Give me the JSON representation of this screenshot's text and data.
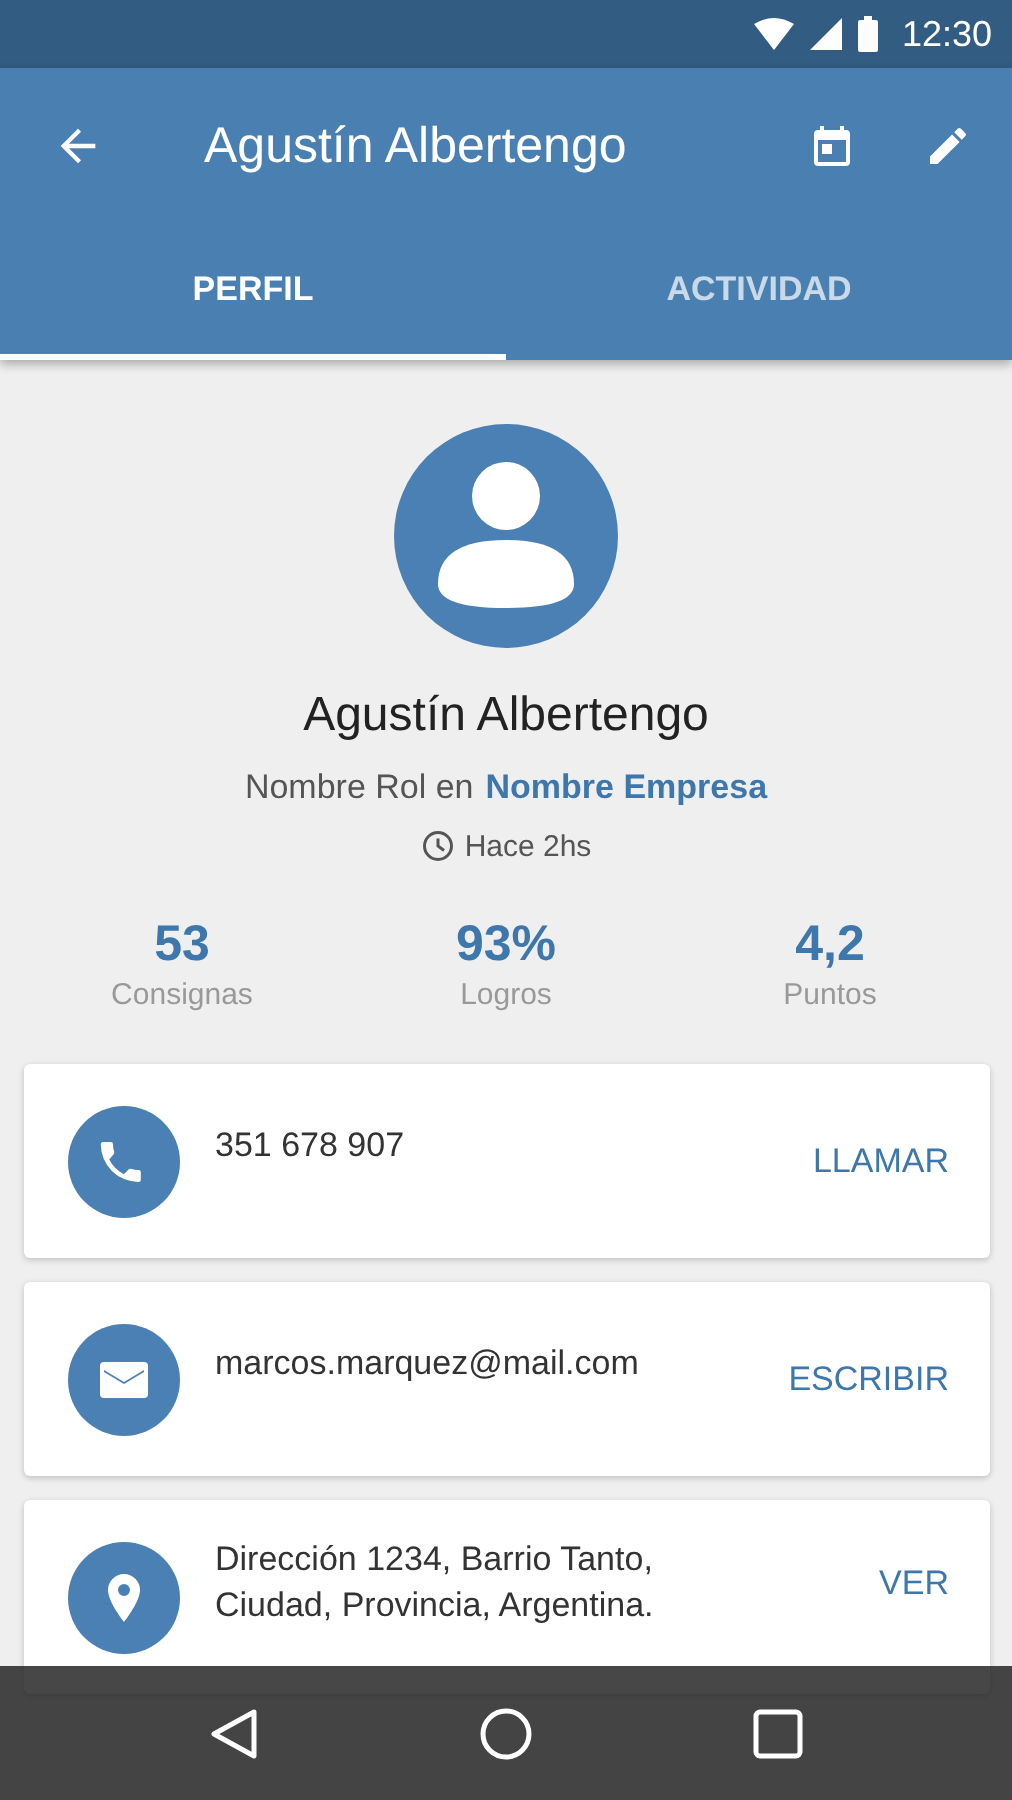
{
  "status_bar": {
    "time": "12:30"
  },
  "app_bar": {
    "title": "Agustín Albertengo"
  },
  "tabs": [
    {
      "label": "PERFIL",
      "selected": true
    },
    {
      "label": "ACTIVIDAD",
      "selected": false
    }
  ],
  "profile": {
    "name": "Agustín Albertengo",
    "role": "Nombre Rol en",
    "company": "Nombre Empresa",
    "last_seen": "Hace 2hs"
  },
  "stats": [
    {
      "value": "53",
      "label": "Consignas"
    },
    {
      "value": "93%",
      "label": "Logros"
    },
    {
      "value": "4,2",
      "label": "Puntos"
    }
  ],
  "contacts": [
    {
      "kind": "phone",
      "text": "351 678 907",
      "action": "LLAMAR"
    },
    {
      "kind": "email",
      "text": "marcos.marquez@mail.com",
      "action": "ESCRIBIR"
    },
    {
      "kind": "location",
      "text": "Dirección 1234, Barrio Tanto, Ciudad, Provincia, Argentina.",
      "action": "VER"
    }
  ]
}
